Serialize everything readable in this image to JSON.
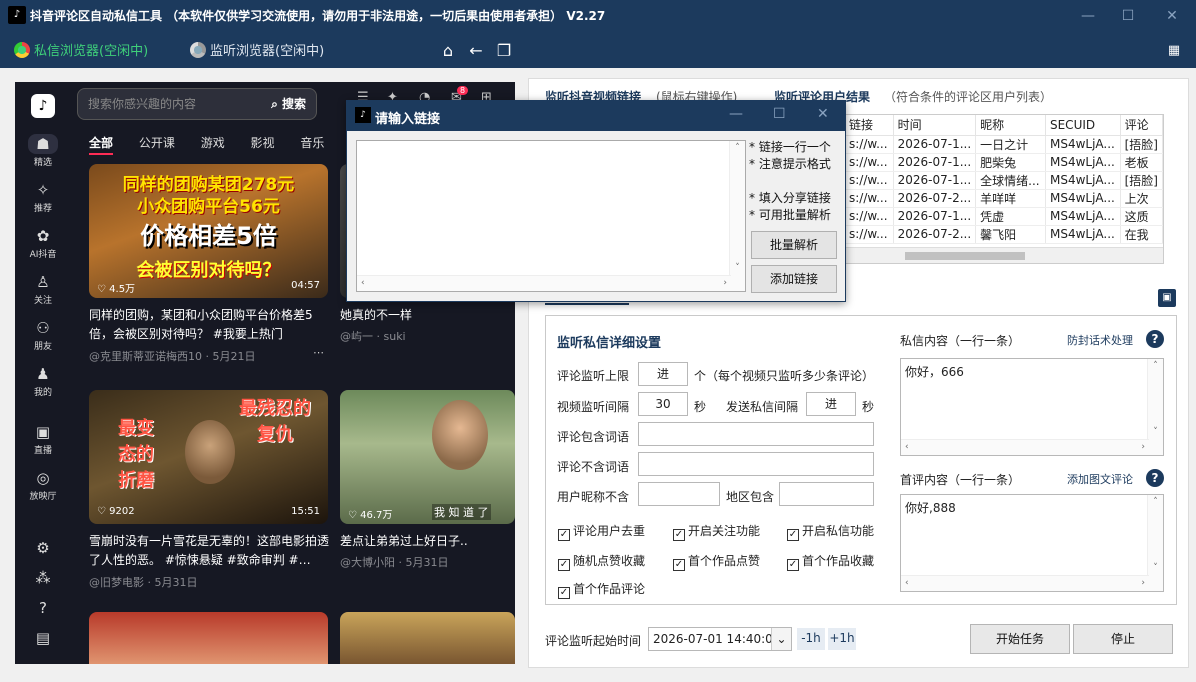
{
  "app": {
    "title": "抖音评论区自动私信工具 （本软件仅供学习交流使用，请勿用于非法用途，一切后果由使用者承担）  V2.27",
    "tabs": [
      {
        "label": "私信浏览器(空闲中)",
        "active": true
      },
      {
        "label": "监听浏览器(空闲中)",
        "active": false
      }
    ]
  },
  "douyin": {
    "search_placeholder": "搜索你感兴趣的内容",
    "search_button": "搜索",
    "notif_badge": "8",
    "sidebar": [
      {
        "label": "精选",
        "icon": "home-icon",
        "active": true
      },
      {
        "label": "推荐",
        "icon": "sparkle-icon"
      },
      {
        "label": "AI抖音",
        "icon": "ai-icon"
      },
      {
        "label": "关注",
        "icon": "follow-icon"
      },
      {
        "label": "朋友",
        "icon": "friends-icon"
      },
      {
        "label": "我的",
        "icon": "user-icon"
      },
      {
        "label": "直播",
        "icon": "tv-icon"
      },
      {
        "label": "放映厅",
        "icon": "film-icon"
      }
    ],
    "categories": [
      "全部",
      "公开课",
      "游戏",
      "影视",
      "音乐"
    ],
    "cards": [
      {
        "thumb_line1": "同样的团购某团278元",
        "thumb_line2": "小众团购平台56元",
        "thumb_line3": "价格相差5倍",
        "thumb_line4": "会被区别对待吗？",
        "likes": "4.5万",
        "duration": "04:57",
        "title": "同样的团购，某团和小众团购平台价格差5倍，会被区别对待吗？ #我要上热门 @DO…",
        "author": "@克里斯蒂亚诺梅西10",
        "date": "5月21日"
      },
      {
        "title": "她真的不一样",
        "author": "@屿一 · suki",
        "date": ""
      },
      {
        "thumb_line1": "最变态的折磨",
        "thumb_line2": "最残忍的复仇",
        "likes": "9202",
        "duration": "15:51",
        "title": "雪崩时没有一片雪花是无辜的！这部电影拍透了人性的恶。 #惊悚悬疑 #致命审判 #…",
        "author": "@旧梦电影",
        "date": "5月31日"
      },
      {
        "thumb_caption": "我 知 道 了",
        "likes": "46.7万",
        "title": "差点让弟弟过上好日子..",
        "author": "@大博小阳",
        "date": "5月31日"
      }
    ]
  },
  "dialog": {
    "title": "请输入链接",
    "hints": [
      "* 链接一行一个",
      "* 注意提示格式",
      "* 填入分享链接",
      "* 可用批量解析"
    ],
    "batch_button": "批量解析",
    "add_button": "添加链接"
  },
  "monitor": {
    "video_link_label": "监听抖音视频链接",
    "video_link_hint": "(鼠标右键操作)",
    "results_label": "监听评论用户结果",
    "results_hint": "（符合条件的评论区用户列表）",
    "columns": [
      "链接",
      "时间",
      "昵称",
      "SECUID",
      "评论"
    ],
    "rows": [
      [
        "s://w...",
        "2026-07-1...",
        "一日之计",
        "MS4wLjA...",
        "[捂脸]"
      ],
      [
        "s://w...",
        "2026-07-1...",
        "肥柴兔",
        "MS4wLjA...",
        "老板"
      ],
      [
        "s://w...",
        "2026-07-1...",
        "全球情绪...",
        "MS4wLjA...",
        "[捂脸]"
      ],
      [
        "s://w...",
        "2026-07-2...",
        "羊咩咩",
        "MS4wLjA...",
        "上次"
      ],
      [
        "s://w...",
        "2026-07-1...",
        "凭虚",
        "MS4wLjA...",
        "这质"
      ],
      [
        "s://w...",
        "2026-07-2...",
        "馨飞阳",
        "MS4wLjA...",
        "在我"
      ]
    ]
  },
  "settings": {
    "section_title": "监听私信详细设置",
    "max_comments_label": "评论监听上限",
    "max_comments_value": "进",
    "max_comments_unit": "个（每个视频只监听多少条评论）",
    "video_interval_label": "视频监听间隔",
    "video_interval_value": "30",
    "seconds_unit": "秒",
    "dm_interval_label": "发送私信间隔",
    "dm_interval_value": "进",
    "seconds_unit2": "秒",
    "include_words_label": "评论包含词语",
    "exclude_words_label": "评论不含词语",
    "nickname_exclude_label": "用户昵称不含",
    "region_include_label": "地区包含",
    "checkboxes": [
      {
        "label": "评论用户去重",
        "checked": true
      },
      {
        "label": "开启关注功能",
        "checked": true
      },
      {
        "label": "开启私信功能",
        "checked": true
      },
      {
        "label": "随机点赞收藏",
        "checked": true
      },
      {
        "label": "首个作品点赞",
        "checked": true
      },
      {
        "label": "首个作品收藏",
        "checked": true
      },
      {
        "label": "首个作品评论",
        "checked": true
      }
    ],
    "dm_content_label": "私信内容（一行一条）",
    "dm_content_link": "防封话术处理",
    "dm_content_value": "你好，666",
    "first_comment_label": "首评内容（一行一条）",
    "first_comment_link": "添加图文评论",
    "first_comment_value": "你好,888"
  },
  "footer": {
    "start_time_label": "评论监听起始时间",
    "start_time_value": "2026-07-01 14:40:04",
    "minus_button": "-1h",
    "plus_button": "+1h",
    "start_button": "开始任务",
    "stop_button": "停止"
  }
}
